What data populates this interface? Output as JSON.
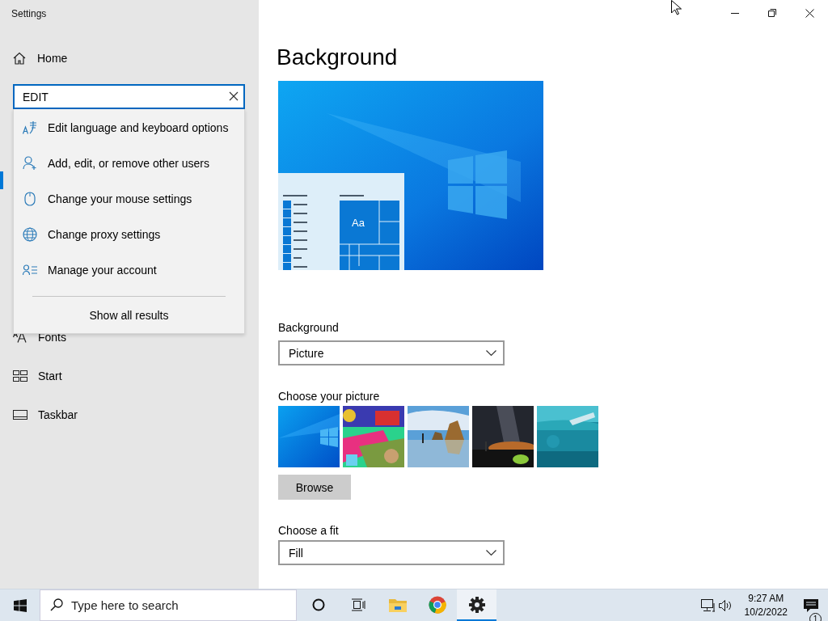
{
  "window": {
    "title": "Settings"
  },
  "sidebar": {
    "home": {
      "label": "Home"
    },
    "search": {
      "value": "EDIT"
    },
    "suggestions": [
      {
        "label": "Edit language and keyboard options"
      },
      {
        "label": "Add, edit, or remove other users"
      },
      {
        "label": "Change your mouse settings"
      },
      {
        "label": "Change proxy settings"
      },
      {
        "label": "Manage your account"
      }
    ],
    "show_all": "Show all results",
    "items": [
      {
        "label": "Fonts"
      },
      {
        "label": "Start"
      },
      {
        "label": "Taskbar"
      }
    ]
  },
  "content": {
    "heading": "Background",
    "preview": {
      "tile_text": "Aa"
    },
    "background": {
      "label": "Background",
      "value": "Picture"
    },
    "picture_chooser": {
      "label": "Choose your picture"
    },
    "browse_button": "Browse",
    "fit": {
      "label": "Choose a fit",
      "value": "Fill"
    }
  },
  "taskbar": {
    "search_placeholder": "Type here to search",
    "apps": [
      {
        "selected": false
      },
      {
        "selected": false
      },
      {
        "selected": false
      },
      {
        "selected": false
      },
      {
        "selected": true
      }
    ],
    "clock": {
      "time": "9:27 AM",
      "date": "10/2/2022"
    },
    "notification_count": "1"
  }
}
